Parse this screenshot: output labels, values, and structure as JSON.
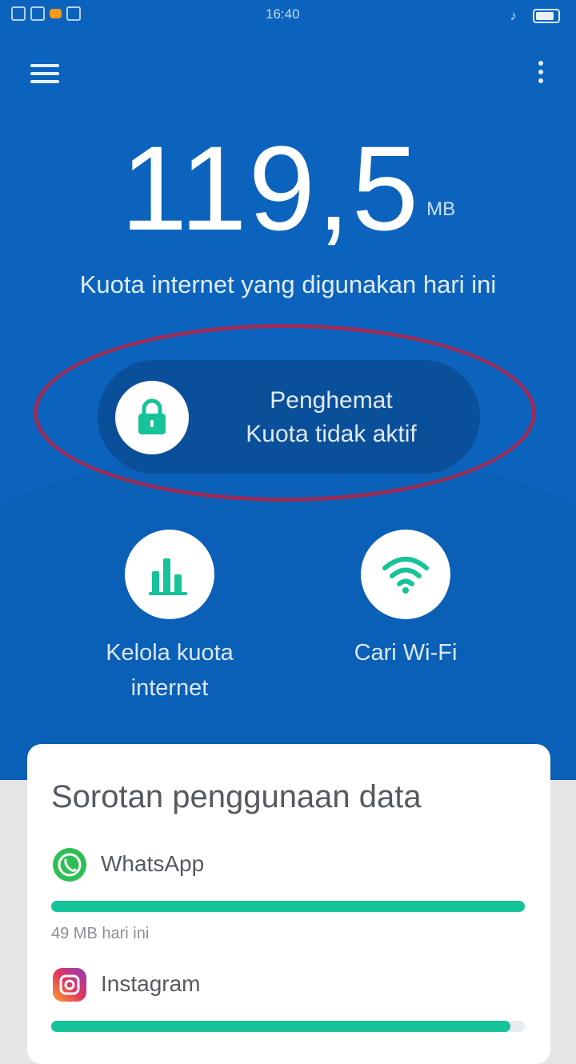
{
  "status_bar": {
    "time": "16:40"
  },
  "header": {
    "menu_icon": "hamburger-menu-icon",
    "more_icon": "more-vertical-icon"
  },
  "usage": {
    "value": "119,5",
    "unit": "MB",
    "caption": "Kuota internet yang digunakan hari ini"
  },
  "saver": {
    "line1": "Penghemat",
    "line2": "Kuota tidak aktif",
    "icon": "lock-icon"
  },
  "tools": [
    {
      "label_line1": "Kelola kuota",
      "label_line2": "internet",
      "icon": "bar-chart-icon"
    },
    {
      "label_line1": "Cari Wi-Fi",
      "icon": "wifi-icon"
    }
  ],
  "highlights": {
    "title": "Sorotan penggunaan data",
    "apps": [
      {
        "name": "WhatsApp",
        "usage": "49 MB hari ini",
        "fill": 1.0
      },
      {
        "name": "Instagram",
        "fill": 0.97
      }
    ]
  },
  "colors": {
    "primary_blue": "#0b63bd",
    "pill_blue": "#0a4f9a",
    "accent_green": "#16c39a",
    "highlight_ring": "#9a2b56"
  }
}
